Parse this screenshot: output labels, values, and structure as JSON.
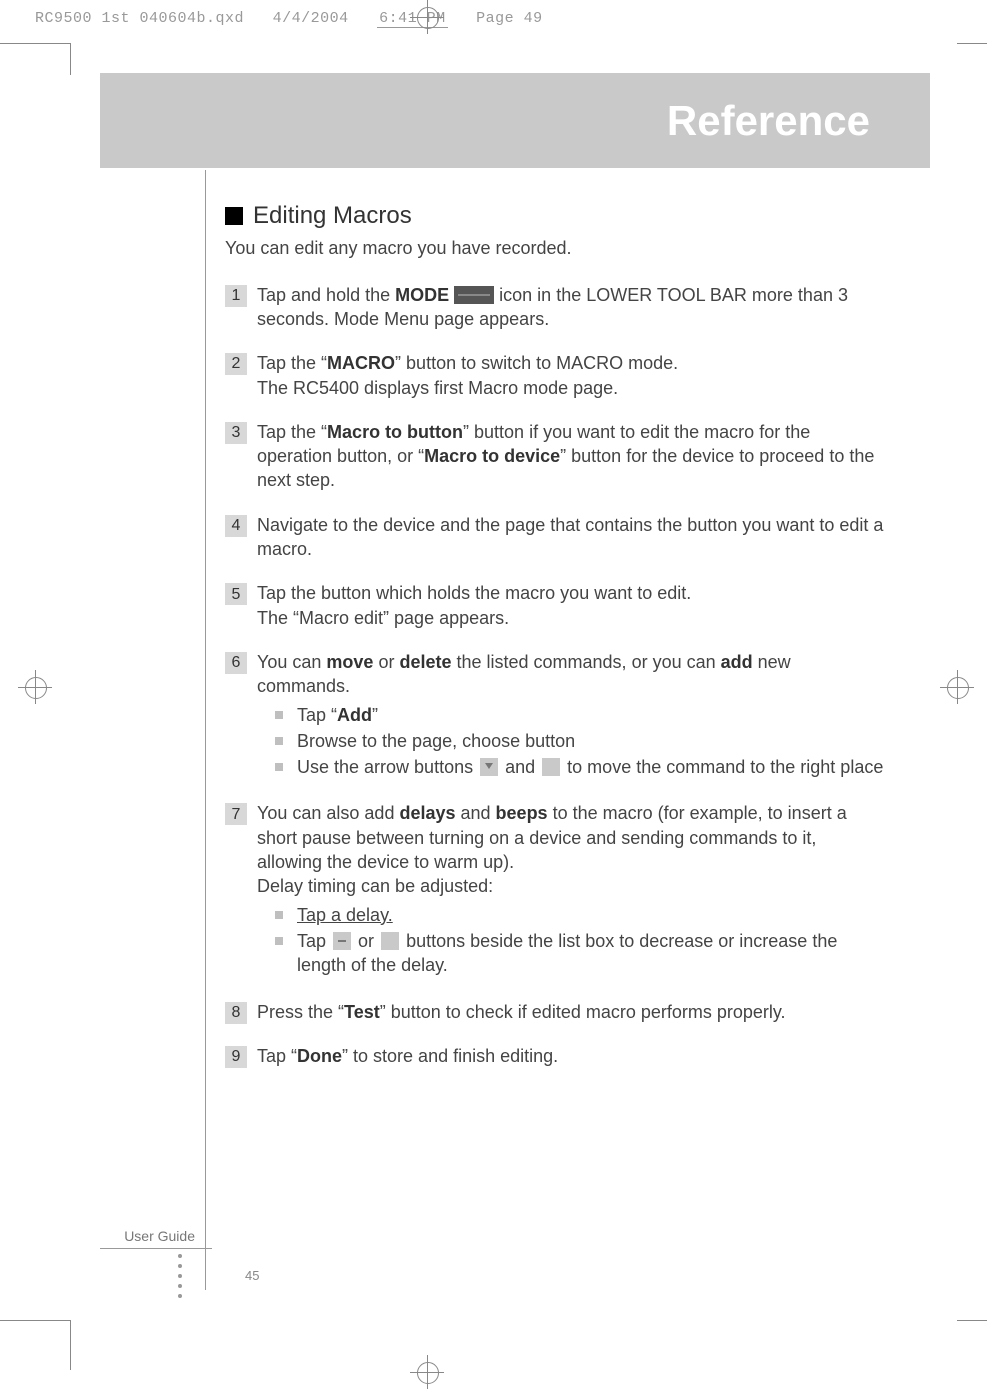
{
  "slug": {
    "file": "RC9500 1st 040604b.qxd",
    "date": "4/4/2004",
    "time": "6:41 PM",
    "page": "Page 49"
  },
  "header": {
    "title": "Reference"
  },
  "section": {
    "title": "Editing Macros",
    "intro": "You can edit any macro you have recorded."
  },
  "steps": [
    {
      "n": "1",
      "pre": "Tap and hold the ",
      "bold1": "MODE",
      "mid": " icon in the LOWER TOOL BAR more than 3 seconds. Mode Menu page appears."
    },
    {
      "n": "2",
      "pre": "Tap the “",
      "bold1": "MACRO",
      "mid": "” button to switch to MACRO mode.",
      "line2": "The RC5400 displays first Macro mode page."
    },
    {
      "n": "3",
      "pre": "Tap the “",
      "bold1": "Macro to button",
      "mid": "” button if you want to edit the macro for the operation button, or “",
      "bold2": "Macro to device",
      "post": "” button for the device to proceed to the next step."
    },
    {
      "n": "4",
      "text": "Navigate to the device and the page that contains the button you want to edit a macro."
    },
    {
      "n": "5",
      "text": "Tap the button which holds the macro you want to edit.",
      "line2": "The “Macro edit” page appears."
    },
    {
      "n": "6",
      "pre": "You can ",
      "bold1": "move",
      "mid": " or ",
      "bold2": "delete",
      "mid2": " the listed commands, or you can ",
      "bold3": "add",
      "post": " new commands.",
      "bullets": [
        {
          "pre": "Tap “",
          "bold": "Add",
          "post": "”"
        },
        {
          "text": "Browse to the page, choose button"
        },
        {
          "pre": "Use the arrow buttons ",
          "mid": " and ",
          "post": " to move the command to the right place"
        }
      ]
    },
    {
      "n": "7",
      "pre": "You can also add ",
      "bold1": "delays",
      "mid": " and ",
      "bold2": "beeps",
      "post": " to the macro (for example, to insert a short pause between turning on a device and sending commands to it, allowing the device to warm up).",
      "line2": "Delay timing can be adjusted:",
      "bullets": [
        {
          "ul": "Tap a delay."
        },
        {
          "pre": "Tap ",
          "mid": " or ",
          "post": " buttons beside the list box to decrease or increase the length of the delay."
        }
      ]
    },
    {
      "n": "8",
      "pre": "Press the “",
      "bold1": "Test",
      "post": "” button to check if edited macro performs properly."
    },
    {
      "n": "9",
      "pre": "Tap “",
      "bold1": "Done",
      "post": "” to store and finish editing."
    }
  ],
  "footer": {
    "label": "User Guide",
    "page": "45"
  }
}
